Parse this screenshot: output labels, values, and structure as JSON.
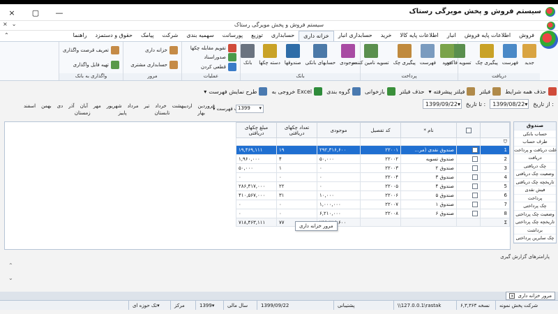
{
  "window": {
    "title": "سیستم فروش و پخش مویرگی رستاک",
    "subtitle": "سیستم فروش و پخش مویرگی رستاک",
    "controls": [
      "×",
      "▢",
      "—"
    ]
  },
  "menu": {
    "tabs": [
      "فروش",
      "اطلاعات پایه فروش",
      "انبار",
      "اطلاعات پایه کالا",
      "خرید",
      "حسابداری انبار",
      "خزانه داری",
      "حسابداری",
      "توزیع",
      "پورسانت",
      "سهمیه بندی",
      "شرکت",
      "پیامک",
      "حقوق و دستمزد",
      "راهنما"
    ],
    "active_index": 6
  },
  "ribbon": {
    "groups": [
      {
        "label": "دریافت",
        "buttons": [
          {
            "label": "جدید",
            "color": "#d9a441"
          },
          {
            "label": "فهرست",
            "color": "#4a89c7"
          },
          {
            "label": "پیگیری چک",
            "color": "#c9a227"
          },
          {
            "label": "تسویه فاکتور",
            "color": "#5a8f4e"
          }
        ]
      },
      {
        "label": "پرداخت",
        "buttons": [
          {
            "label": "جدید",
            "color": "#7aa34a"
          },
          {
            "label": "فهرست",
            "color": "#7a9bbf"
          },
          {
            "label": "پیگیری چک",
            "color": "#c08a3e"
          },
          {
            "label": "تسویه نامین کننده",
            "color": "#5a8f4e"
          }
        ]
      },
      {
        "label": "بانک",
        "buttons": [
          {
            "label": "موجودی",
            "color": "#a84ba3"
          },
          {
            "label": "حسابهای بانکی",
            "color": "#4b79a8"
          },
          {
            "label": "صندوقها",
            "color": "#2f6da8"
          },
          {
            "label": "دسته چکها",
            "color": "#c9a227"
          },
          {
            "label": "بانک",
            "color": "#6a7380"
          }
        ]
      },
      {
        "label": "عملیات",
        "small": [
          {
            "label": "تقویم مقابله چکها",
            "color": "#d04b3a"
          },
          {
            "label": "صدوراسناد",
            "color": "#4a9a4a"
          },
          {
            "label": "قطعی کردن",
            "color": "#3a7bc8"
          }
        ]
      },
      {
        "label": "مرور",
        "buttons": [
          {
            "label": "خزانه داری",
            "color": "#c58b47"
          },
          {
            "label": "حسابداری مشتری",
            "color": "#c58b47"
          }
        ]
      },
      {
        "label": "واگذاری به بانک",
        "small": [
          {
            "label": "تعریف قرصت واگذاری",
            "color": "#c58b47"
          },
          {
            "label": "تهیه فایل واگذاری",
            "color": "#5a9a4a"
          }
        ]
      }
    ]
  },
  "toolbar": {
    "items": [
      {
        "label": "حذف همه شرایط",
        "icon": "delete-icon",
        "color": "#d04b3a"
      },
      {
        "label": "فیلتر",
        "icon": "filter-icon",
        "color": "#b08a4a"
      },
      {
        "label": "فیلتر پیشرفته",
        "icon": "advanced-filter-icon",
        "color": "#b08a4a"
      },
      {
        "label": "حذف فیلتر",
        "icon": "clear-filter-icon",
        "color": "#999999"
      },
      {
        "label": "بازخوانی",
        "icon": "refresh-icon",
        "color": "#3a8f3a"
      },
      {
        "label": "گروه بندی",
        "icon": "group-icon",
        "color": "#4a7ab0"
      },
      {
        "label": "خروجی به Excel",
        "icon": "excel-icon",
        "color": "#2e8b3a"
      },
      {
        "label": "طرح نمایش فهرست",
        "icon": "layout-icon",
        "color": "#4a7ab0"
      },
      {
        "label": "چاپ فهرست",
        "icon": "print-icon",
        "color": "#6b7785"
      }
    ]
  },
  "filter": {
    "from_label": "از تاریخ :",
    "from_value": "1399/08/22",
    "to_label": "تا تاریخ :",
    "to_value": "1399/09/22",
    "year": "1399"
  },
  "months": [
    "فروردین",
    "اردیبهشت",
    "خرداد",
    "تیر",
    "مرداد",
    "شهریور",
    "مهر",
    "آبان",
    "آذر",
    "دی",
    "بهمن",
    "اسفند"
  ],
  "seasons": [
    "بهار",
    "تابستان",
    "پاییز",
    "زمستان"
  ],
  "sidebar": {
    "header": "صندوق",
    "items": [
      "حساب بانکی",
      "طرف حساب",
      "علت دریافت و پرداخت",
      "دریافت",
      "چک دریافتی",
      "وضعیت چک دریافتی",
      "تاریخچه چک دریافتی",
      "فیش نقدی",
      "پرداخت",
      "چک پرداختی",
      "وضعیت چک پرداختی",
      "تاریخچه چک پرداختی",
      "برداشت",
      "چک سایرین پرداختی"
    ]
  },
  "grid": {
    "headers": [
      "نام *",
      "کد تفصیل",
      "موجودی",
      "تعداد چکهای دریافتی",
      "مبلغ چکهای دریافتی"
    ],
    "rows": [
      {
        "n": "1",
        "name": "صندوق نقدی (مر...",
        "code": "۲۲۰۰۱",
        "balance": "۲۹۲,۳۱۶,۶۰۰",
        "count": "۱۹",
        "amount": "۱۹,۴۶۹,۱۱۱"
      },
      {
        "n": "2",
        "name": "صندوق تسویه",
        "code": "۲۲۰۰۲",
        "balance": "۵۰,۰۰۰",
        "count": "۴",
        "amount": "۱,۹۶۰,۰۰۰"
      },
      {
        "n": "3",
        "name": "صندوق ۲",
        "code": "۲۲۰۰۳",
        "balance": "۰",
        "count": "۱",
        "amount": "۵۰,۰۰۰"
      },
      {
        "n": "4",
        "name": "صندوق ۳",
        "code": "۲۲۰۰۴",
        "balance": "۰",
        "count": "۰",
        "amount": "۰"
      },
      {
        "n": "5",
        "name": "صندوق ۴",
        "code": "۲۲۰۰۵",
        "balance": "۰",
        "count": "۲۲",
        "amount": "۲۸۶,۴۱۷,۰۰۰"
      },
      {
        "n": "6",
        "name": "صندوق ۵",
        "code": "۲۲۰۰۶",
        "balance": "۱۰,۰۰۰",
        "count": "۳۱",
        "amount": "۴۱۰,۵۶۷,۰۰۰"
      },
      {
        "n": "7",
        "name": "صندوق ۱",
        "code": "۲۲۰۰۷",
        "balance": "۱,۰۰۰,۰۰۰",
        "count": "۰",
        "amount": "۰"
      },
      {
        "n": "8",
        "name": "صندوق ۶",
        "code": "۲۲۰۰۸",
        "balance": "۶,۲۱۰,۰۰۰",
        "count": "۰",
        "amount": "۰"
      }
    ],
    "footer": {
      "sigma": "Σ",
      "balance": "۲۹۹,۷۸۶,۶۰۰",
      "count": "۷۷",
      "amount": "۷۱۸,۴۶۳,۱۱۱"
    },
    "selected_index": 0
  },
  "tooltip": "مرور خزانه داری",
  "params_label": "پارامترهای گزارش گیری",
  "window_tab": {
    "label": "مرور خزانه داری"
  },
  "status": {
    "company": "شرکت پخش نمونه",
    "version": "نسخه ۶,۳,۳۶۳",
    "db": "\\\\127.0.0.1\\rastak",
    "support": "پشتیبانی",
    "date": "1399/09/22",
    "fiscal_label": "سال مالی",
    "fiscal_year": "1399",
    "center_label": "مرکز",
    "center_value": "تک حوزه ای"
  }
}
